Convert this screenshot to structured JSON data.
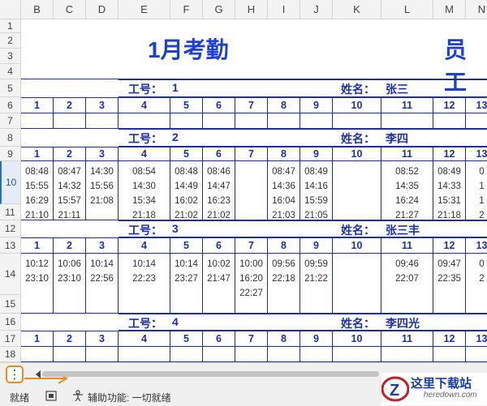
{
  "columns": [
    "B",
    "C",
    "D",
    "E",
    "F",
    "G",
    "H",
    "I",
    "J",
    "K",
    "L",
    "M",
    "N"
  ],
  "rows": [
    "1",
    "2",
    "3",
    "4",
    "5",
    "6",
    "7",
    "8",
    "9",
    "10",
    "11",
    "12",
    "13",
    "14",
    "15",
    "16",
    "17",
    "18"
  ],
  "title_left": "1月考勤",
  "title_right": "员 工",
  "labels": {
    "id": "工号：",
    "name": "姓名："
  },
  "days": [
    "1",
    "2",
    "3",
    "4",
    "5",
    "6",
    "7",
    "8",
    "9",
    "10",
    "11",
    "12",
    "13"
  ],
  "employees": [
    {
      "id": "1",
      "name": "张三",
      "times": []
    },
    {
      "id": "2",
      "name": "李四",
      "times": [
        [
          "08:48",
          "15:55",
          "16:29",
          "21:10"
        ],
        [
          "08:47",
          "14:32",
          "15:57",
          "21:11"
        ],
        [
          "14:30",
          "15:56",
          "21:08"
        ],
        [
          "08:54",
          "14:30",
          "15:34",
          "21:18"
        ],
        [
          "08:48",
          "14:49",
          "16:02",
          "21:02"
        ],
        [
          "08:46",
          "14:47",
          "16:23",
          "21:02"
        ],
        [],
        [
          "08:47",
          "14:36",
          "16:04",
          "21:03"
        ],
        [
          "08:49",
          "14:16",
          "15:59",
          "21:05"
        ],
        [],
        [
          "08:52",
          "14:35",
          "16:24",
          "21:27"
        ],
        [
          "08:49",
          "14:33",
          "15:31",
          "21:18"
        ],
        [
          "0",
          "1",
          "1",
          "2"
        ]
      ]
    },
    {
      "id": "3",
      "name": "张三丰",
      "times": [
        [
          "10:12",
          "23:10"
        ],
        [
          "10:06",
          "23:10"
        ],
        [
          "10:14",
          "22:56"
        ],
        [
          "10:14",
          "22:23"
        ],
        [
          "10:14",
          "23:27"
        ],
        [
          "10:02",
          "21:47"
        ],
        [
          "10:00",
          "16:20",
          "22:27"
        ],
        [
          "09:56",
          "22:18"
        ],
        [
          "09:59",
          "21:22"
        ],
        [],
        [
          "09:46",
          "22:07"
        ],
        [
          "09:47",
          "22:35"
        ],
        [
          "0",
          "2"
        ]
      ]
    },
    {
      "id": "4",
      "name": "李四光",
      "times": []
    }
  ],
  "status": {
    "ready": "就绪",
    "accessibility": "辅助功能: 一切就绪"
  },
  "logo": {
    "text": "这里下载站",
    "url": "heredown.com"
  },
  "colors": {
    "accent": "#1f2fa8",
    "border": "#1f2f9a",
    "highlight": "#f08a1c"
  }
}
